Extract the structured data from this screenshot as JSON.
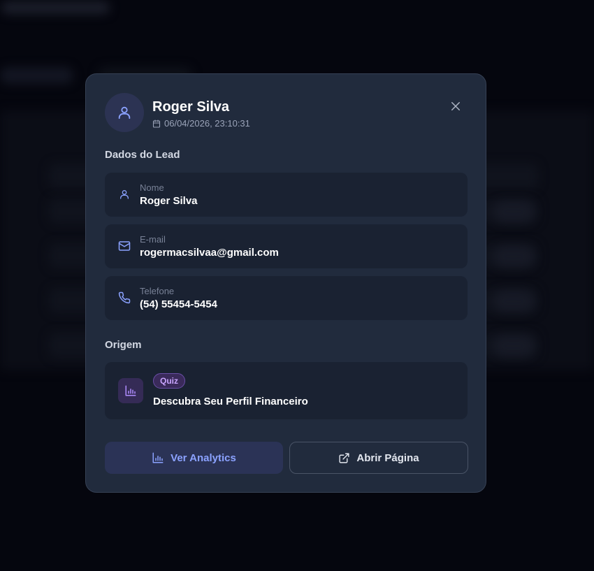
{
  "lead": {
    "name": "Roger Silva",
    "datetime": "06/04/2026, 23:10:31"
  },
  "sections": {
    "lead_data_title": "Dados do Lead",
    "origin_title": "Origem"
  },
  "fields": [
    {
      "label": "Nome",
      "value": "Roger Silva",
      "icon": "user-icon"
    },
    {
      "label": "E-mail",
      "value": "rogermacsilvaa@gmail.com",
      "icon": "mail-icon"
    },
    {
      "label": "Telefone",
      "value": "(54) 55454-5454",
      "icon": "phone-icon"
    }
  ],
  "origin": {
    "badge": "Quiz",
    "title": "Descubra Seu Perfil Financeiro",
    "icon": "bar-chart-icon"
  },
  "actions": {
    "analytics_label": "Ver Analytics",
    "open_page_label": "Abrir Página"
  },
  "colors": {
    "modal_bg": "#212b3d",
    "card_bg": "#1a2232",
    "accent": "#8ba2ff",
    "quiz_accent": "#c9a5ff"
  }
}
